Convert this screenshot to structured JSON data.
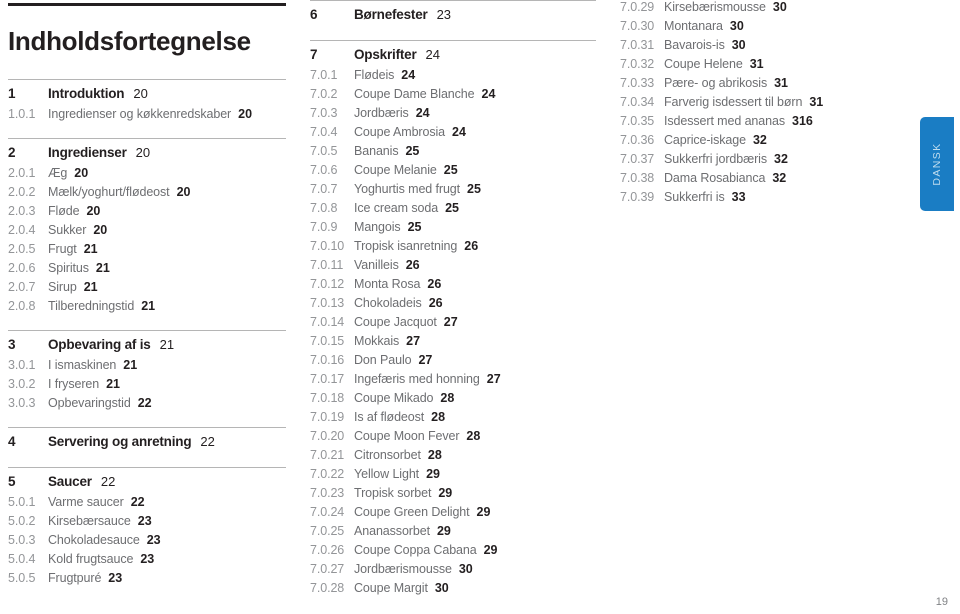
{
  "document": {
    "title": "Indholdsfortegnelse",
    "page_number": "19",
    "language_tab": "DANSK",
    "accent_color": "#1a7dc4",
    "rule_color": "#b5b5b5",
    "title_rule_color": "#231f20"
  },
  "columns": [
    {
      "id": "left",
      "sections": [
        {
          "head": {
            "num": "1",
            "title": "Introduktion",
            "page": "20"
          },
          "entries": [
            {
              "num": "1.0.1",
              "title": "Ingredienser og køkkenredskaber",
              "page": "20"
            }
          ]
        },
        {
          "head": {
            "num": "2",
            "title": "Ingredienser",
            "page": "20"
          },
          "entries": [
            {
              "num": "2.0.1",
              "title": "Æg",
              "page": "20"
            },
            {
              "num": "2.0.2",
              "title": "Mælk/yoghurt/flødeost",
              "page": "20"
            },
            {
              "num": "2.0.3",
              "title": "Fløde",
              "page": "20"
            },
            {
              "num": "2.0.4",
              "title": "Sukker",
              "page": "20"
            },
            {
              "num": "2.0.5",
              "title": "Frugt",
              "page": "21"
            },
            {
              "num": "2.0.6",
              "title": "Spiritus",
              "page": "21"
            },
            {
              "num": "2.0.7",
              "title": "Sirup",
              "page": "21"
            },
            {
              "num": "2.0.8",
              "title": "Tilberedningstid",
              "page": "21"
            }
          ]
        },
        {
          "head": {
            "num": "3",
            "title": "Opbevaring af is",
            "page": "21"
          },
          "entries": [
            {
              "num": "3.0.1",
              "title": "I ismaskinen",
              "page": "21"
            },
            {
              "num": "3.0.2",
              "title": "I fryseren",
              "page": "21"
            },
            {
              "num": "3.0.3",
              "title": "Opbevaringstid",
              "page": "22"
            }
          ]
        },
        {
          "head": {
            "num": "4",
            "title": "Servering og anretning",
            "page": "22"
          },
          "entries": []
        },
        {
          "head": {
            "num": "5",
            "title": "Saucer",
            "page": "22"
          },
          "entries": [
            {
              "num": "5.0.1",
              "title": "Varme saucer",
              "page": "22"
            },
            {
              "num": "5.0.2",
              "title": "Kirsebærsauce",
              "page": "23"
            },
            {
              "num": "5.0.3",
              "title": "Chokoladesauce",
              "page": "23"
            },
            {
              "num": "5.0.4",
              "title": "Kold frugtsauce",
              "page": "23"
            },
            {
              "num": "5.0.5",
              "title": "Frugtpuré",
              "page": "23"
            }
          ]
        }
      ]
    },
    {
      "id": "mid",
      "sections": [
        {
          "head": {
            "num": "6",
            "title": "Børnefester",
            "page": "23"
          },
          "entries": []
        },
        {
          "head": {
            "num": "7",
            "title": "Opskrifter",
            "page": "24"
          },
          "entries": [
            {
              "num": "7.0.1",
              "title": "Flødeis",
              "page": "24"
            },
            {
              "num": "7.0.2",
              "title": "Coupe Dame Blanche",
              "page": "24"
            },
            {
              "num": "7.0.3",
              "title": "Jordbæris",
              "page": "24"
            },
            {
              "num": "7.0.4",
              "title": "Coupe Ambrosia",
              "page": "24"
            },
            {
              "num": "7.0.5",
              "title": "Bananis",
              "page": "25"
            },
            {
              "num": "7.0.6",
              "title": "Coupe Melanie",
              "page": "25"
            },
            {
              "num": "7.0.7",
              "title": "Yoghurtis med frugt",
              "page": "25"
            },
            {
              "num": "7.0.8",
              "title": "Ice cream soda",
              "page": "25"
            },
            {
              "num": "7.0.9",
              "title": "Mangois",
              "page": "25"
            },
            {
              "num": "7.0.10",
              "title": "Tropisk isanretning",
              "page": "26"
            },
            {
              "num": "7.0.11",
              "title": "Vanilleis",
              "page": "26"
            },
            {
              "num": "7.0.12",
              "title": "Monta Rosa",
              "page": "26"
            },
            {
              "num": "7.0.13",
              "title": "Chokoladeis",
              "page": "26"
            },
            {
              "num": "7.0.14",
              "title": "Coupe Jacquot",
              "page": "27"
            },
            {
              "num": "7.0.15",
              "title": "Mokkais",
              "page": "27"
            },
            {
              "num": "7.0.16",
              "title": "Don Paulo",
              "page": "27"
            },
            {
              "num": "7.0.17",
              "title": "Ingefæris med honning",
              "page": "27"
            },
            {
              "num": "7.0.18",
              "title": "Coupe Mikado",
              "page": "28"
            },
            {
              "num": "7.0.19",
              "title": "Is af flødeost",
              "page": "28"
            },
            {
              "num": "7.0.20",
              "title": "Coupe Moon Fever",
              "page": "28"
            },
            {
              "num": "7.0.21",
              "title": "Citronsorbet",
              "page": "28"
            },
            {
              "num": "7.0.22",
              "title": "Yellow Light",
              "page": "29"
            },
            {
              "num": "7.0.23",
              "title": "Tropisk sorbet",
              "page": "29"
            },
            {
              "num": "7.0.24",
              "title": "Coupe Green Delight",
              "page": "29"
            },
            {
              "num": "7.0.25",
              "title": "Ananassorbet",
              "page": "29"
            },
            {
              "num": "7.0.26",
              "title": "Coupe Coppa Cabana",
              "page": "29"
            },
            {
              "num": "7.0.27",
              "title": "Jordbærismousse",
              "page": "30"
            },
            {
              "num": "7.0.28",
              "title": "Coupe Margit",
              "page": "30"
            }
          ]
        }
      ]
    },
    {
      "id": "right",
      "sections": [
        {
          "head": null,
          "entries": [
            {
              "num": "7.0.29",
              "title": "Kirsebærismousse",
              "page": "30"
            },
            {
              "num": "7.0.30",
              "title": "Montanara",
              "page": "30"
            },
            {
              "num": "7.0.31",
              "title": "Bavarois-is",
              "page": "30"
            },
            {
              "num": "7.0.32",
              "title": "Coupe Helene",
              "page": "31"
            },
            {
              "num": "7.0.33",
              "title": "Pære- og abrikosis",
              "page": "31"
            },
            {
              "num": "7.0.34",
              "title": "Farverig isdessert til børn",
              "page": "31"
            },
            {
              "num": "7.0.35",
              "title": "Isdessert med ananas",
              "page": "316"
            },
            {
              "num": "7.0.36",
              "title": "Caprice-iskage",
              "page": "32"
            },
            {
              "num": "7.0.37",
              "title": "Sukkerfri jordbæris",
              "page": "32"
            },
            {
              "num": "7.0.38",
              "title": "Dama Rosabianca",
              "page": "32"
            },
            {
              "num": "7.0.39",
              "title": "Sukkerfri is",
              "page": "33"
            }
          ]
        }
      ]
    }
  ]
}
